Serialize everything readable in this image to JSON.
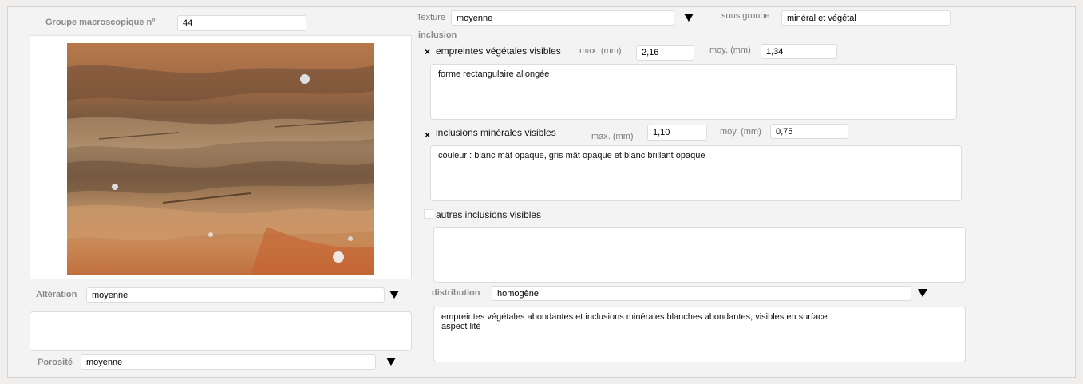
{
  "left": {
    "group_label": "Groupe macroscopique n°",
    "group_value": "44",
    "photo_icon": "rock-sample-photo",
    "alteration_label": "Altération",
    "alteration_value": "moyenne",
    "alteration_note": "",
    "porosite_label": "Porosité",
    "porosite_value": "moyenne"
  },
  "right": {
    "texture_label": "Texture",
    "texture_value": "moyenne",
    "sous_groupe_label": "sous groupe",
    "sous_groupe_value": "minéral et végétal",
    "inclusion_label": "inclusion",
    "vegetal": {
      "checked_mark": "×",
      "label": "empreintes végétales visibles",
      "max_label": "max. (mm)",
      "max_value": "2,16",
      "moy_label": "moy. (mm)",
      "moy_value": "1,34",
      "note": "forme rectangulaire allongée"
    },
    "mineral": {
      "checked_mark": "×",
      "label": "inclusions minérales visibles",
      "max_label": "max. (mm)",
      "max_value": "1,10",
      "moy_label": "moy. (mm)",
      "moy_value": "0,75",
      "note": "couleur : blanc mât opaque, gris mât opaque et blanc brillant opaque"
    },
    "autres": {
      "label": "autres inclusions visibles",
      "note": ""
    },
    "distribution_label": "distribution",
    "distribution_value": "homogène",
    "distribution_note": "empreintes végétales abondantes et inclusions minérales blanches abondantes, visibles en surface\naspect lité"
  },
  "icons": {
    "dropdown": "triangle-down-icon",
    "check": "x-mark-icon"
  }
}
